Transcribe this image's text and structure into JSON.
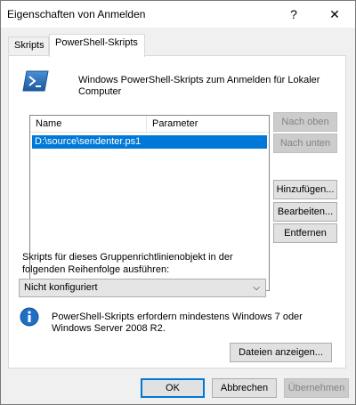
{
  "window": {
    "title": "Eigenschaften von Anmelden",
    "help_glyph": "?",
    "close_glyph": "✕"
  },
  "tabs": [
    {
      "label": "Skripts",
      "active": false
    },
    {
      "label": "PowerShell-Skripts",
      "active": true
    }
  ],
  "header": {
    "icon": "powershell-icon",
    "description": "Windows PowerShell-Skripts zum Anmelden für Lokaler Computer"
  },
  "scripts_list": {
    "columns": [
      "Name",
      "Parameter"
    ],
    "rows": [
      {
        "name": "D:\\source\\sendenter.ps1",
        "parameter": "",
        "selected": true
      }
    ]
  },
  "side_buttons": {
    "move_up": "Nach oben",
    "move_down": "Nach unten",
    "add": "Hinzufügen...",
    "edit": "Bearbeiten...",
    "remove": "Entfernen"
  },
  "order": {
    "label": "Skripts für dieses Gruppenrichtlinienobjekt in der folgenden Reihenfolge ausführen:",
    "selected_value": "Nicht konfiguriert"
  },
  "info": {
    "icon": "info-icon",
    "text": "PowerShell-Skripts erfordern mindestens Windows 7 oder Windows Server 2008 R2."
  },
  "buttons": {
    "show_files": "Dateien anzeigen...",
    "ok": "OK",
    "cancel": "Abbrechen",
    "apply": "Übernehmen"
  },
  "colors": {
    "selection": "#0078d7",
    "accent": "#0078d7"
  }
}
